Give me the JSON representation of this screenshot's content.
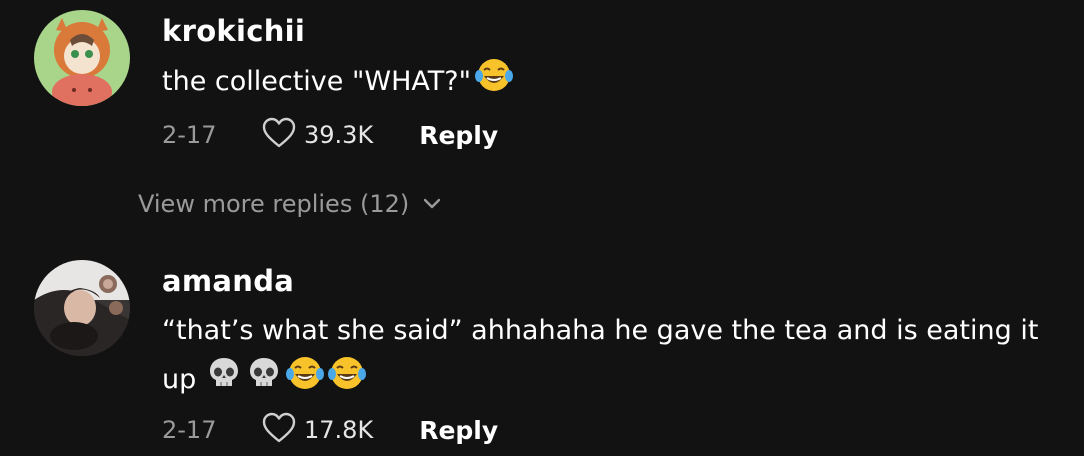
{
  "comments": [
    {
      "username": "krokichii",
      "text": "the collective \"WHAT?\"",
      "emojis": [
        "laughing-tears-emoji"
      ],
      "date": "2-17",
      "likes": "39.3K",
      "reply_label": "Reply"
    },
    {
      "username": "amanda",
      "text": "“that’s what she said” ahhahaha he gave the tea and is eating it up",
      "emojis": [
        "skull-emoji",
        "skull-emoji",
        "laughing-tears-emoji",
        "laughing-tears-emoji"
      ],
      "date": "2-17",
      "likes": "17.8K",
      "reply_label": "Reply"
    }
  ],
  "view_more_replies": "View more replies (12)",
  "colors": {
    "background": "#121212",
    "primary_text": "#ffffff",
    "secondary_text": "#9a9a9a"
  }
}
